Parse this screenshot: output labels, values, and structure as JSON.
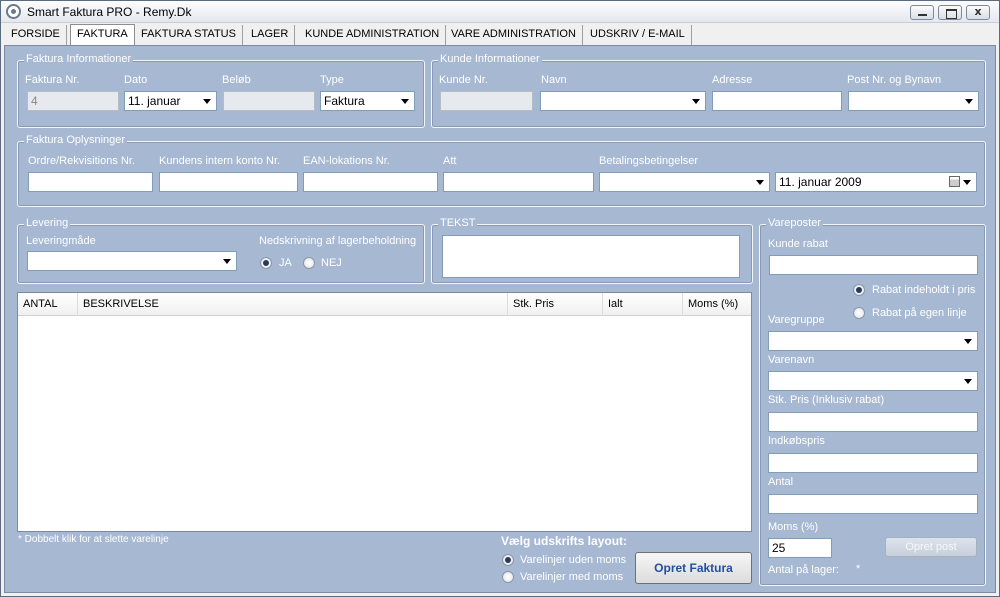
{
  "window": {
    "title": "Smart Faktura PRO  -  Remy.Dk",
    "close_glyph": "x"
  },
  "tabs": [
    "FORSIDE",
    "FAKTURA",
    "FAKTURA STATUS",
    "LAGER",
    "KUNDE ADMINISTRATION",
    "VARE ADMINISTRATION",
    "UDSKRIV / E-MAIL"
  ],
  "faktura_info": {
    "legend": "Faktura Informationer",
    "nr_label": "Faktura Nr.",
    "nr_value": "4",
    "dato_label": "Dato",
    "dato_value": "11.     januar",
    "belob_label": "Beløb",
    "belob_value": "",
    "type_label": "Type",
    "type_value": "Faktura"
  },
  "kunde_info": {
    "legend": "Kunde Informationer",
    "nr_label": "Kunde Nr.",
    "navn_label": "Navn",
    "adresse_label": "Adresse",
    "post_label": "Post Nr. og Bynavn"
  },
  "faktura_oplys": {
    "legend": "Faktura Oplysninger",
    "ordre_label": "Ordre/Rekvisitions Nr.",
    "konto_label": "Kundens intern konto Nr.",
    "ean_label": "EAN-lokations Nr.",
    "att_label": "Att",
    "betaling_label": "Betalingsbetingelser",
    "date_value": "11.    januar     2009"
  },
  "levering": {
    "legend": "Levering",
    "made_label": "Leveringmåde",
    "ned_label": "Nedskrivning af lagerbeholdning",
    "ja_label": "JA",
    "nej_label": "NEJ"
  },
  "tekst": {
    "legend": "TEKST"
  },
  "grid": {
    "columns": [
      "ANTAL",
      "BESKRIVELSE",
      "Stk. Pris",
      "Ialt",
      "Moms (%)"
    ]
  },
  "footer": {
    "hint": "* Dobbelt klik for at slette varelinje",
    "layout_label": "Vælg udskrifts layout:",
    "opt1": "Varelinjer uden moms",
    "opt2": "Varelinjer med moms",
    "opret_button": "Opret Faktura"
  },
  "vareposter": {
    "legend": "Vareposter",
    "rabat_label": "Kunde rabat",
    "rabat_opt1": "Rabat indeholdt i pris",
    "rabat_opt2": "Rabat på egen linje",
    "gruppe_label": "Varegruppe",
    "navn_label": "Varenavn",
    "pris_label": "Stk. Pris (Inklusiv rabat)",
    "indkob_label": "Indkøbspris",
    "antal_label": "Antal",
    "moms_label": "Moms (%)",
    "moms_value": "25",
    "post_button": "Opret post",
    "lager_label": "Antal på lager:",
    "lager_value": "*"
  }
}
